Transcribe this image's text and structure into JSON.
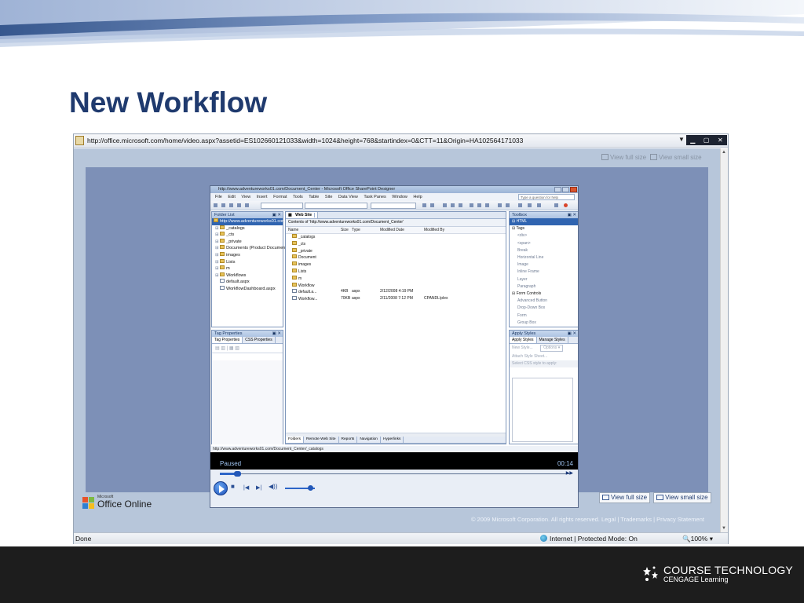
{
  "slide": {
    "title": "New Workflow"
  },
  "browser": {
    "url": "http://office.microsoft.com/home/video.aspx?assetid=ES102660121033&width=1024&height=768&startindex=0&CTT=11&Origin=HA102564171033",
    "view_full_size": "View full size",
    "view_small_size": "View small size",
    "status_done": "Done",
    "status_zone": "Internet | Protected Mode: On",
    "status_zoom": "100%",
    "copyright": "© 2009 Microsoft Corporation. All rights reserved. Legal | Trademarks | Privacy Statement",
    "logo_small": "Microsoft",
    "logo_name": "Office Online"
  },
  "designer": {
    "window_title": "http://www.adventureworks01.com/Document_Center - Microsoft Office SharePoint Designer",
    "menu": [
      "File",
      "Edit",
      "View",
      "Insert",
      "Format",
      "Tools",
      "Table",
      "Site",
      "Data View",
      "Task Panes",
      "Window",
      "Help"
    ],
    "ask_placeholder": "Type a question for help",
    "folder_list": {
      "title": "Folder List",
      "items": [
        {
          "label": "http://www.adventureworks01.com",
          "selected": true,
          "doc": false
        },
        {
          "label": "_catalogs",
          "selected": false,
          "doc": false
        },
        {
          "label": "_cts",
          "selected": false,
          "doc": false
        },
        {
          "label": "_private",
          "selected": false,
          "doc": false
        },
        {
          "label": "Documents (Product Documenta",
          "selected": false,
          "doc": false
        },
        {
          "label": "images",
          "selected": false,
          "doc": false
        },
        {
          "label": "Lists",
          "selected": false,
          "doc": false
        },
        {
          "label": "m",
          "selected": false,
          "doc": false
        },
        {
          "label": "Workflows",
          "selected": false,
          "doc": false
        },
        {
          "label": "default.aspx",
          "selected": false,
          "doc": true
        },
        {
          "label": "WorkflowDashboard.aspx",
          "selected": false,
          "doc": true
        }
      ]
    },
    "tag_properties": {
      "title": "Tag Properties",
      "tabs": [
        "Tag Properties",
        "CSS Properties"
      ]
    },
    "website": {
      "tab": "Web Site",
      "contents": "Contents of 'http://www.adventureworks01.com/Document_Center'",
      "headers": [
        "Name",
        "Size",
        "Type",
        "Modified Date",
        "Modified By"
      ],
      "folders": [
        "_catalogs",
        "_cts",
        "_private",
        "Document",
        "images",
        "Lists",
        "m",
        "Workflow"
      ],
      "files": [
        {
          "name": "default.a...",
          "size": "4KB",
          "type": "aspx",
          "modified": "2/12/2008 4:19 PM",
          "by": ""
        },
        {
          "name": "Workflow...",
          "size": "70KB",
          "type": "aspx",
          "modified": "2/11/2008 7:12 PM",
          "by": "CPANDL\\plex"
        }
      ],
      "bottom_tabs": [
        "Folders",
        "Remote Web Site",
        "Reports",
        "Navigation",
        "Hyperlinks"
      ]
    },
    "toolbox": {
      "title": "Toolbox",
      "sections": [
        {
          "label": "HTML",
          "header": true
        },
        {
          "label": "Tags",
          "header": true
        },
        {
          "label": "<div>",
          "header": false
        },
        {
          "label": "<span>",
          "header": false
        },
        {
          "label": "Break",
          "header": false
        },
        {
          "label": "Horizontal Line",
          "header": false
        },
        {
          "label": "Image",
          "header": false
        },
        {
          "label": "Inline Frame",
          "header": false
        },
        {
          "label": "Layer",
          "header": false
        },
        {
          "label": "Paragraph",
          "header": false
        },
        {
          "label": "Form Controls",
          "header": true
        },
        {
          "label": "Advanced Button",
          "header": false
        },
        {
          "label": "Drop-Down Box",
          "header": false
        },
        {
          "label": "Form",
          "header": false
        },
        {
          "label": "Group Box",
          "header": false
        }
      ]
    },
    "apply_styles": {
      "title": "Apply Styles",
      "tabs": [
        "Apply Styles",
        "Manage Styles"
      ],
      "new_style": "New Style...",
      "options": "Options",
      "attach": "Attach Style Sheet...",
      "select": "Select CSS style to apply:"
    },
    "status_url": "http://www.adventureworks01.com/Document_Center/_catalogs"
  },
  "player": {
    "state": "Paused",
    "time": "00:14",
    "progress_fraction": 0.05,
    "volume_fraction": 0.85
  },
  "branding": {
    "line1": "COURSE TECHNOLOGY",
    "line2": "CENGAGE Learning"
  },
  "colors": {
    "title": "#1f3a6e",
    "page_bg": "#b7c6da",
    "video_bg": "#7d90b7",
    "footer": "#1d1d1d",
    "accent_blue": "#2d65c8"
  }
}
